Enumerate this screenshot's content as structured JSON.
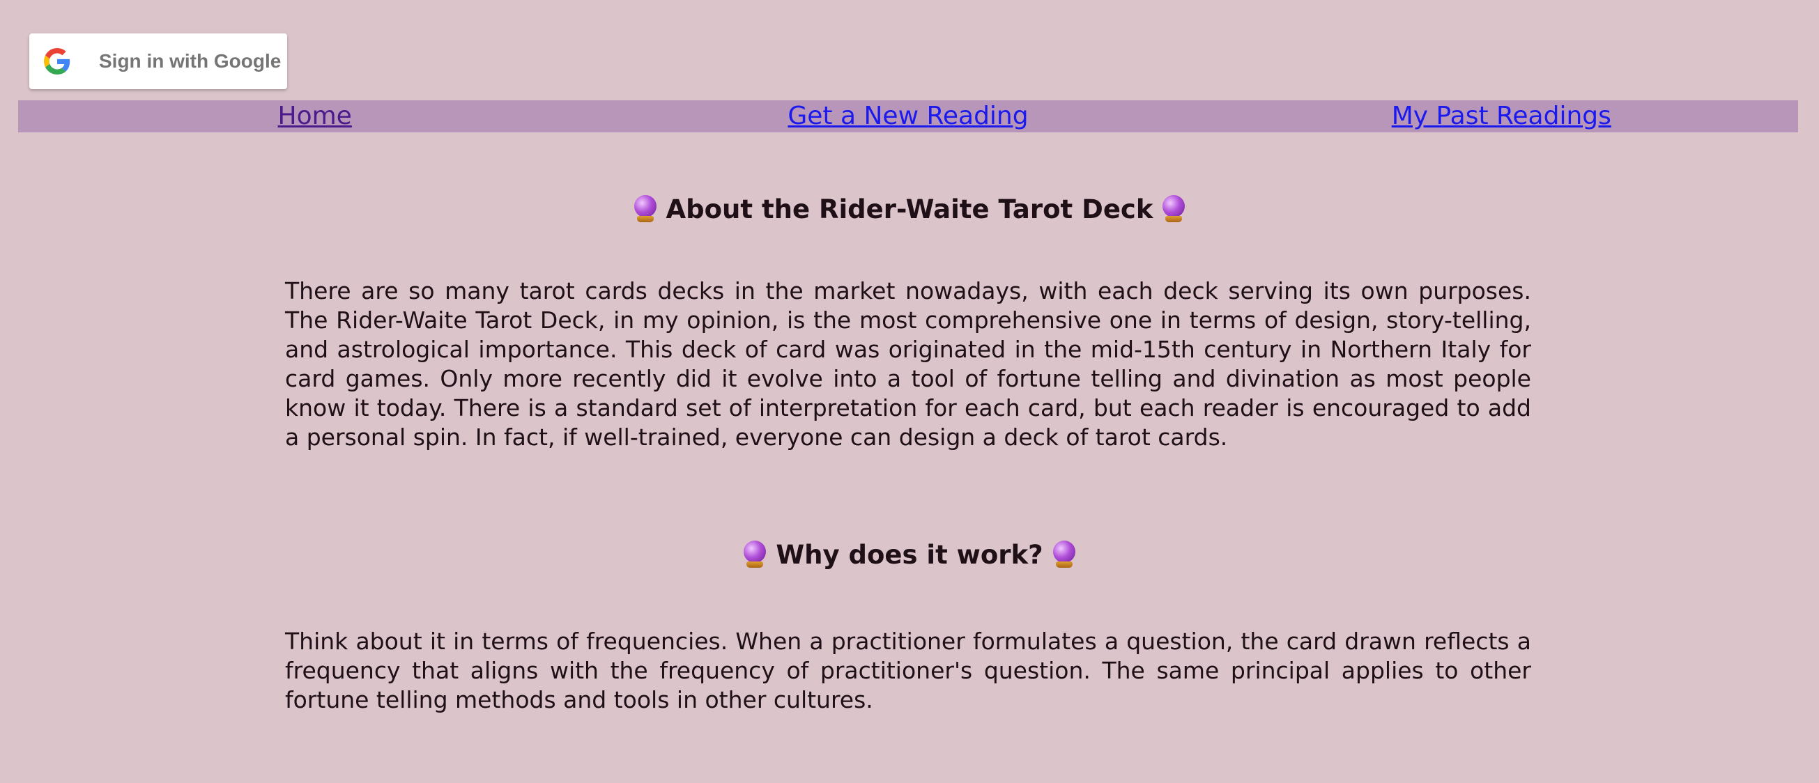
{
  "auth": {
    "google_button_label": "Sign in with Google",
    "icon": "google-g-icon"
  },
  "nav": {
    "items": [
      {
        "label": "Home",
        "visited": true
      },
      {
        "label": "Get a New Reading",
        "visited": false
      },
      {
        "label": "My Past Readings",
        "visited": false
      }
    ]
  },
  "sections": [
    {
      "heading": "About the Rider-Waite Tarot Deck",
      "icon": "crystal-ball-icon",
      "body": "There are so many tarot cards decks in the market nowadays, with each deck serving its own purposes. The Rider-Waite Tarot Deck, in my opinion, is the most comprehensive one in terms of design, story-telling, and astrological importance. This deck of card was originated in the mid-15th century in Northern Italy for card games. Only more recently did it evolve into a tool of fortune telling and divination as most people know it today. There is a standard set of interpretation for each card, but each reader is encouraged to add a personal spin. In fact, if well-trained, everyone can design a deck of tarot cards."
    },
    {
      "heading": "Why does it work?",
      "icon": "crystal-ball-icon",
      "body": "Think about it in terms of frequencies. When a practitioner formulates a question, the card drawn reflects a frequency that aligns with the frequency of practitioner's question. The same principal applies to other fortune telling methods and tools in other cultures."
    }
  ],
  "colors": {
    "background": "#dbc5cb",
    "navbar": "#b896b9",
    "link": "#1a1aee",
    "link_visited": "#4b1a8c",
    "text": "#1f0f17"
  }
}
